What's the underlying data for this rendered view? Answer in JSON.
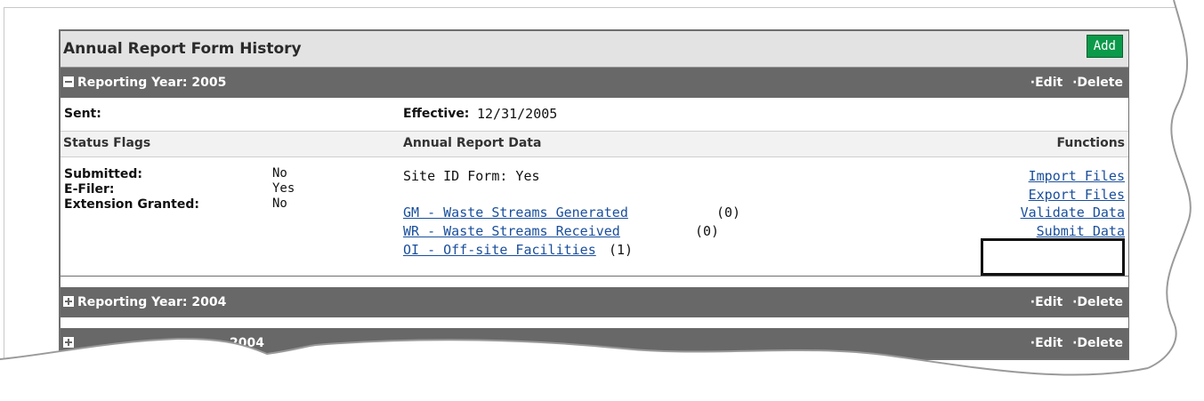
{
  "panel": {
    "title": "Annual Report Form History",
    "add_label": "Add"
  },
  "years": [
    {
      "label": "Reporting Year: 2005",
      "expanded": true,
      "edit_label": "·Edit",
      "delete_label": "·Delete"
    },
    {
      "label": "Reporting Year: 2004",
      "expanded": false,
      "edit_label": "·Edit",
      "delete_label": "·Delete"
    },
    {
      "label": "2004",
      "expanded": false,
      "edit_label": "·Edit",
      "delete_label": "·Delete"
    }
  ],
  "detail": {
    "sent_label": "Sent:",
    "effective_label": "Effective:",
    "effective_value": "12/31/2005",
    "col_status": "Status Flags",
    "col_report": "Annual Report Data",
    "col_functions": "Functions",
    "flags": [
      {
        "label": "Submitted:",
        "value": "No"
      },
      {
        "label": "E-Filer:",
        "value": "Yes"
      },
      {
        "label": "Extension Granted:",
        "value": "No"
      }
    ],
    "site_id": "Site ID Form: Yes",
    "forms": [
      {
        "label": "GM - Waste Streams Generated",
        "count": "(0)"
      },
      {
        "label": "WR - Waste Streams Received",
        "count": "(0)"
      },
      {
        "label": "OI - Off-site Facilities",
        "count": "(1)"
      }
    ],
    "functions": [
      "Import Files",
      "Export Files",
      "Validate Data",
      "Submit Data"
    ]
  },
  "colors": {
    "bar": "#686868",
    "add_button": "#0b9a4a",
    "link": "#1a4f9c"
  }
}
